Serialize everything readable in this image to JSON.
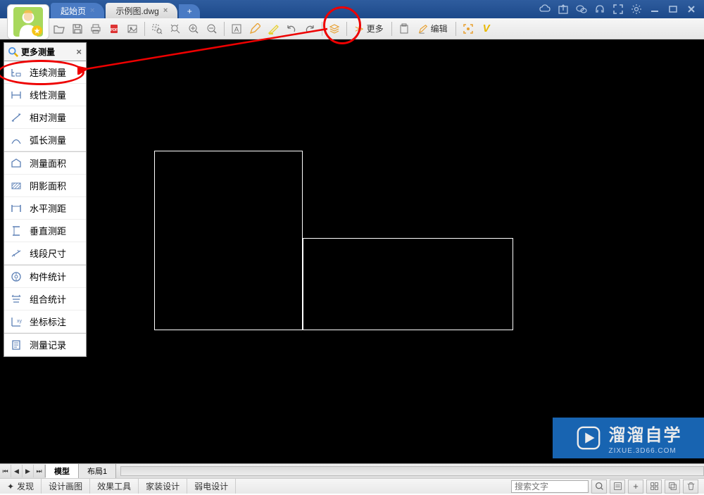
{
  "tabs": {
    "start": "起始页",
    "file": "示例图.dwg",
    "add": "+"
  },
  "toolbar": {
    "more_label": "更多",
    "edit_label": "编辑"
  },
  "panel": {
    "title": "更多测量",
    "items": [
      {
        "label": "连续测量"
      },
      {
        "label": "线性测量"
      },
      {
        "label": "相对测量"
      },
      {
        "label": "弧长测量"
      },
      {
        "label": "测量面积"
      },
      {
        "label": "阴影面积"
      },
      {
        "label": "水平测距"
      },
      {
        "label": "垂直测距"
      },
      {
        "label": "线段尺寸"
      },
      {
        "label": "构件统计"
      },
      {
        "label": "组合统计"
      },
      {
        "label": "坐标标注"
      },
      {
        "label": "测量记录"
      }
    ]
  },
  "layout_tabs": {
    "model": "模型",
    "layout1": "布局1"
  },
  "bottom_tabs": {
    "discover": "发现",
    "design_draw": "设计画图",
    "effect_tool": "效果工具",
    "home_design": "家装设计",
    "weak_current": "弱电设计"
  },
  "search": {
    "placeholder": "搜索文字"
  },
  "watermark": {
    "main": "溜溜自学",
    "sub": "ZIXUE.3D66.COM"
  }
}
